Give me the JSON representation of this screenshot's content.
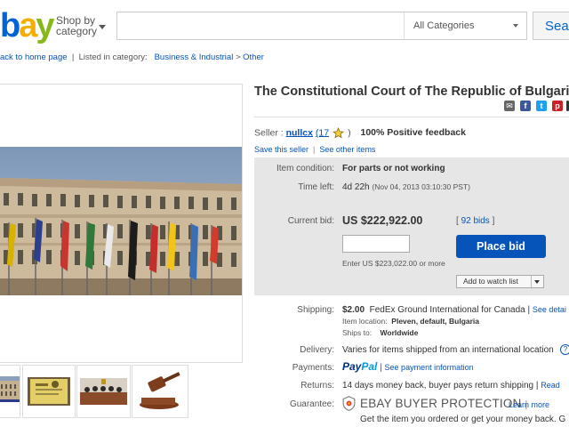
{
  "header": {
    "logo_parts": [
      "b",
      "a",
      "y"
    ],
    "shop_by_line1": "Shop by",
    "shop_by_line2": "category",
    "search_placeholder": "",
    "category_select": "All Categories",
    "search_button": "Sear"
  },
  "breadcrumb": {
    "back": "ack to home page",
    "separator": "|",
    "listed_in": "Listed in category:",
    "cat1": "Business & Industrial",
    "arrow": ">",
    "cat2": "Other"
  },
  "thumbnails": [
    "building-thumb",
    "document-thumb",
    "courtroom-thumb",
    "gavel-thumb"
  ],
  "item": {
    "title": "The Constitutional Court of The Republic of Bulgaria",
    "seller_label": "Seller :",
    "seller_name": "nullcx",
    "seller_score_open": "(17",
    "seller_score_close": ")",
    "positive_feedback": "100% Positive feedback",
    "save_seller": "Save this seller",
    "links_sep": "|",
    "see_other": "See other items"
  },
  "bid": {
    "condition_label": "Item condition:",
    "condition_value": "For parts or not working",
    "time_label": "Time left:",
    "time_value": "4d 22h",
    "time_detail": "(Nov 04, 2013  03:10:30 PST)",
    "current_bid_label": "Current bid:",
    "price": "US $222,922.00",
    "bids_open": "[",
    "bids_count": "92 bids",
    "bids_close": "]",
    "bid_input_value": "",
    "place_bid": "Place bid",
    "enter_hint": "Enter US $223,022.00 or more",
    "watch_list": "Add to watch list"
  },
  "shipping": {
    "label": "Shipping:",
    "cost": "$2.00",
    "service": "FedEx Ground International for Canada |",
    "see_details": "See detai",
    "location_label": "Item location:",
    "location_value": "Pleven, default, Bulgaria",
    "ships_to_label": "Ships to:",
    "ships_to_value": "Worldwide"
  },
  "delivery": {
    "label": "Delivery:",
    "value": "Varies for items shipped from an international location"
  },
  "payments": {
    "label": "Payments:",
    "paypal_1": "Pay",
    "paypal_2": "Pal",
    "sep": "|",
    "see_info": "See payment information"
  },
  "returns": {
    "label": "Returns:",
    "value": "14 days money back, buyer pays return shipping |",
    "read": "Read"
  },
  "guarantee": {
    "label": "Guarantee:",
    "title": "EBAY BUYER PROTECTION",
    "sep": "|",
    "learn_more": "Learn more",
    "sub": "Get the item you ordered or get your money back. G"
  },
  "colors": {
    "ebay_red": "#e53238",
    "ebay_blue": "#0064d2",
    "ebay_yellow": "#f5af02",
    "ebay_green": "#86b817",
    "link_blue": "#0654ba",
    "bid_panel_bg": "#e6e6e6",
    "place_bid_bg": "#0654ba"
  }
}
